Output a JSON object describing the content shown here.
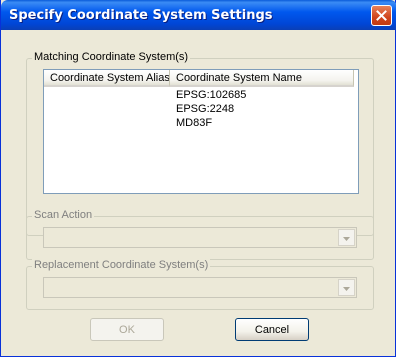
{
  "window": {
    "title": "Specify Coordinate System Settings"
  },
  "matching_group": {
    "label": "Matching Coordinate System(s)",
    "columns": [
      "Coordinate System Alias",
      "Coordinate System Name"
    ],
    "rows": [
      {
        "alias": "",
        "name": "EPSG:102685"
      },
      {
        "alias": "",
        "name": "EPSG:2248"
      },
      {
        "alias": "",
        "name": "MD83F"
      }
    ]
  },
  "scan_action_group": {
    "label": "Scan Action",
    "selected": ""
  },
  "replacement_group": {
    "label": "Replacement Coordinate System(s)",
    "selected": ""
  },
  "buttons": {
    "ok": "OK",
    "cancel": "Cancel"
  },
  "icons": {
    "close": "close-icon",
    "dropdown": "chevron-down-icon"
  },
  "colors": {
    "titlebar": "#0058ee",
    "dialog_bg": "#ece9d8",
    "close_button": "#d0451d"
  }
}
